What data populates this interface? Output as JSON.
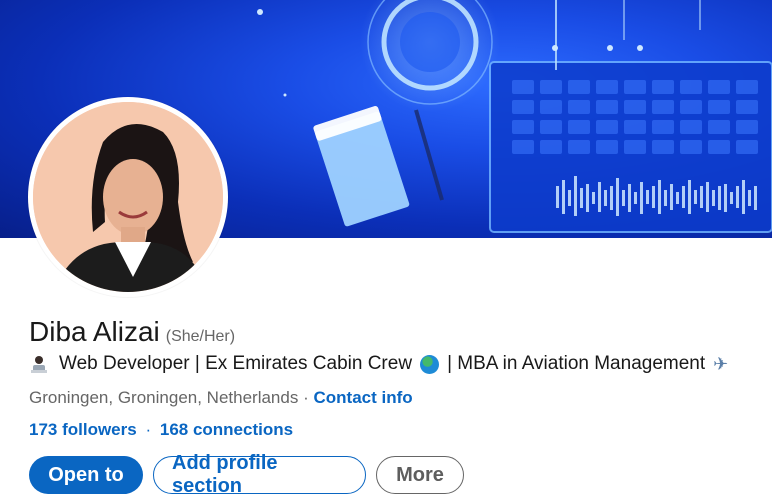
{
  "profile": {
    "name": "Diba Alizai",
    "pronouns": "(She/Her)",
    "headline": "Web Developer | Ex Emirates Cabin Crew",
    "headline_tail": "| MBA in Aviation Management",
    "location": "Groningen, Groningen, Netherlands",
    "separator": "·",
    "contact_info": "Contact info",
    "followers": "173 followers",
    "connections": "168 connections"
  },
  "actions": {
    "open_to": "Open to",
    "add_profile_section": "Add profile section",
    "more": "More"
  },
  "icons": {
    "headline_lead": "woman-technologist-icon",
    "headline_mid": "globe-icon",
    "headline_end": "airplane-icon"
  },
  "colors": {
    "brand_blue": "#0a66c2",
    "banner_blue": "#1a4de6"
  }
}
